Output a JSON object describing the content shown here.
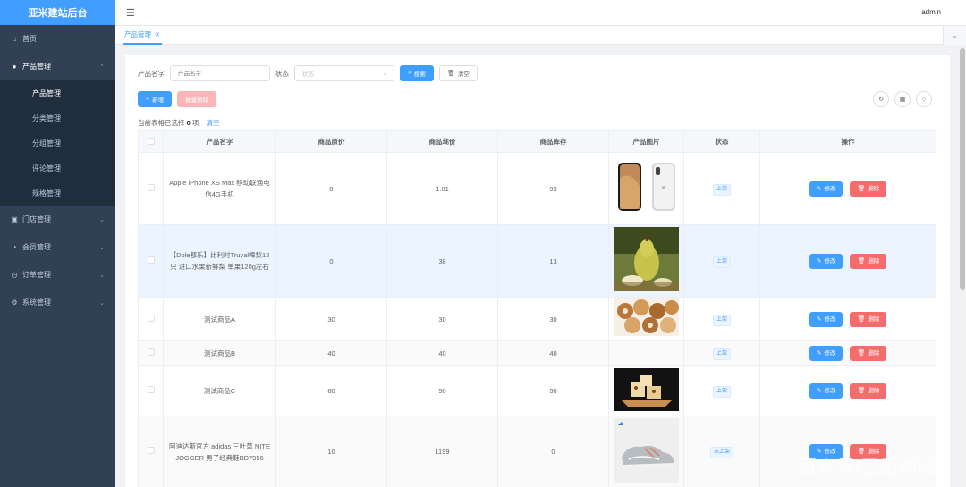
{
  "app": {
    "title": "亚米建站后台",
    "user": "admin"
  },
  "sidebar": {
    "items": [
      {
        "label": "首页",
        "icon": "home-icon"
      },
      {
        "label": "产品管理",
        "icon": "user-icon",
        "open": true,
        "children": [
          "产品管理",
          "分类管理",
          "分组管理",
          "评论管理",
          "规格管理"
        ]
      },
      {
        "label": "门店管理",
        "icon": "store-icon"
      },
      {
        "label": "会员管理",
        "icon": "member-icon"
      },
      {
        "label": "订单管理",
        "icon": "order-icon"
      },
      {
        "label": "系统管理",
        "icon": "gear-icon"
      }
    ]
  },
  "tabs": [
    {
      "label": "产品管理"
    }
  ],
  "search": {
    "name_label": "产品名字",
    "name_placeholder": "产品名字",
    "status_label": "状态",
    "status_placeholder": "状态",
    "search_btn": "搜索",
    "clear_btn": "清空"
  },
  "actions": {
    "add": "新增",
    "batch_delete": "批量删除"
  },
  "selection": {
    "prefix": "当前表格已选择",
    "count": "0",
    "suffix": "项",
    "clear": "清空"
  },
  "table": {
    "columns": [
      "产品名字",
      "商品原价",
      "商品现价",
      "商品库存",
      "产品图片",
      "状态",
      "操作"
    ],
    "edit_label": "修改",
    "delete_label": "删除",
    "rows": [
      {
        "name": "Apple iPhone XS Max 移动联通电信4G手机",
        "orig": "0",
        "price": "1.01",
        "stock": "93",
        "status": "上架",
        "image": "iphone"
      },
      {
        "name": "【Dole都乐】比利时Truval啤梨12只 进口水果新鲜梨 单果120g左右",
        "orig": "0",
        "price": "38",
        "stock": "13",
        "status": "上架",
        "image": "pear"
      },
      {
        "name": "测试商品A",
        "orig": "30",
        "price": "30",
        "stock": "30",
        "status": "上架",
        "image": "cookies"
      },
      {
        "name": "测试商品B",
        "orig": "40",
        "price": "40",
        "stock": "40",
        "status": "上架",
        "image": ""
      },
      {
        "name": "测试商品C",
        "orig": "60",
        "price": "50",
        "stock": "50",
        "status": "上架",
        "image": "cake"
      },
      {
        "name": "阿迪达斯官方 adidas 三叶草 NITE JOGGER 男子经典鞋BD7956",
        "orig": "10",
        "price": "1199",
        "stock": "0",
        "status": "未上架",
        "image": "shoe"
      }
    ]
  },
  "watermark": "百家号/卫画楠520",
  "colors": {
    "primary": "#409eff",
    "danger": "#f56c6c",
    "sidebar": "#304156"
  }
}
